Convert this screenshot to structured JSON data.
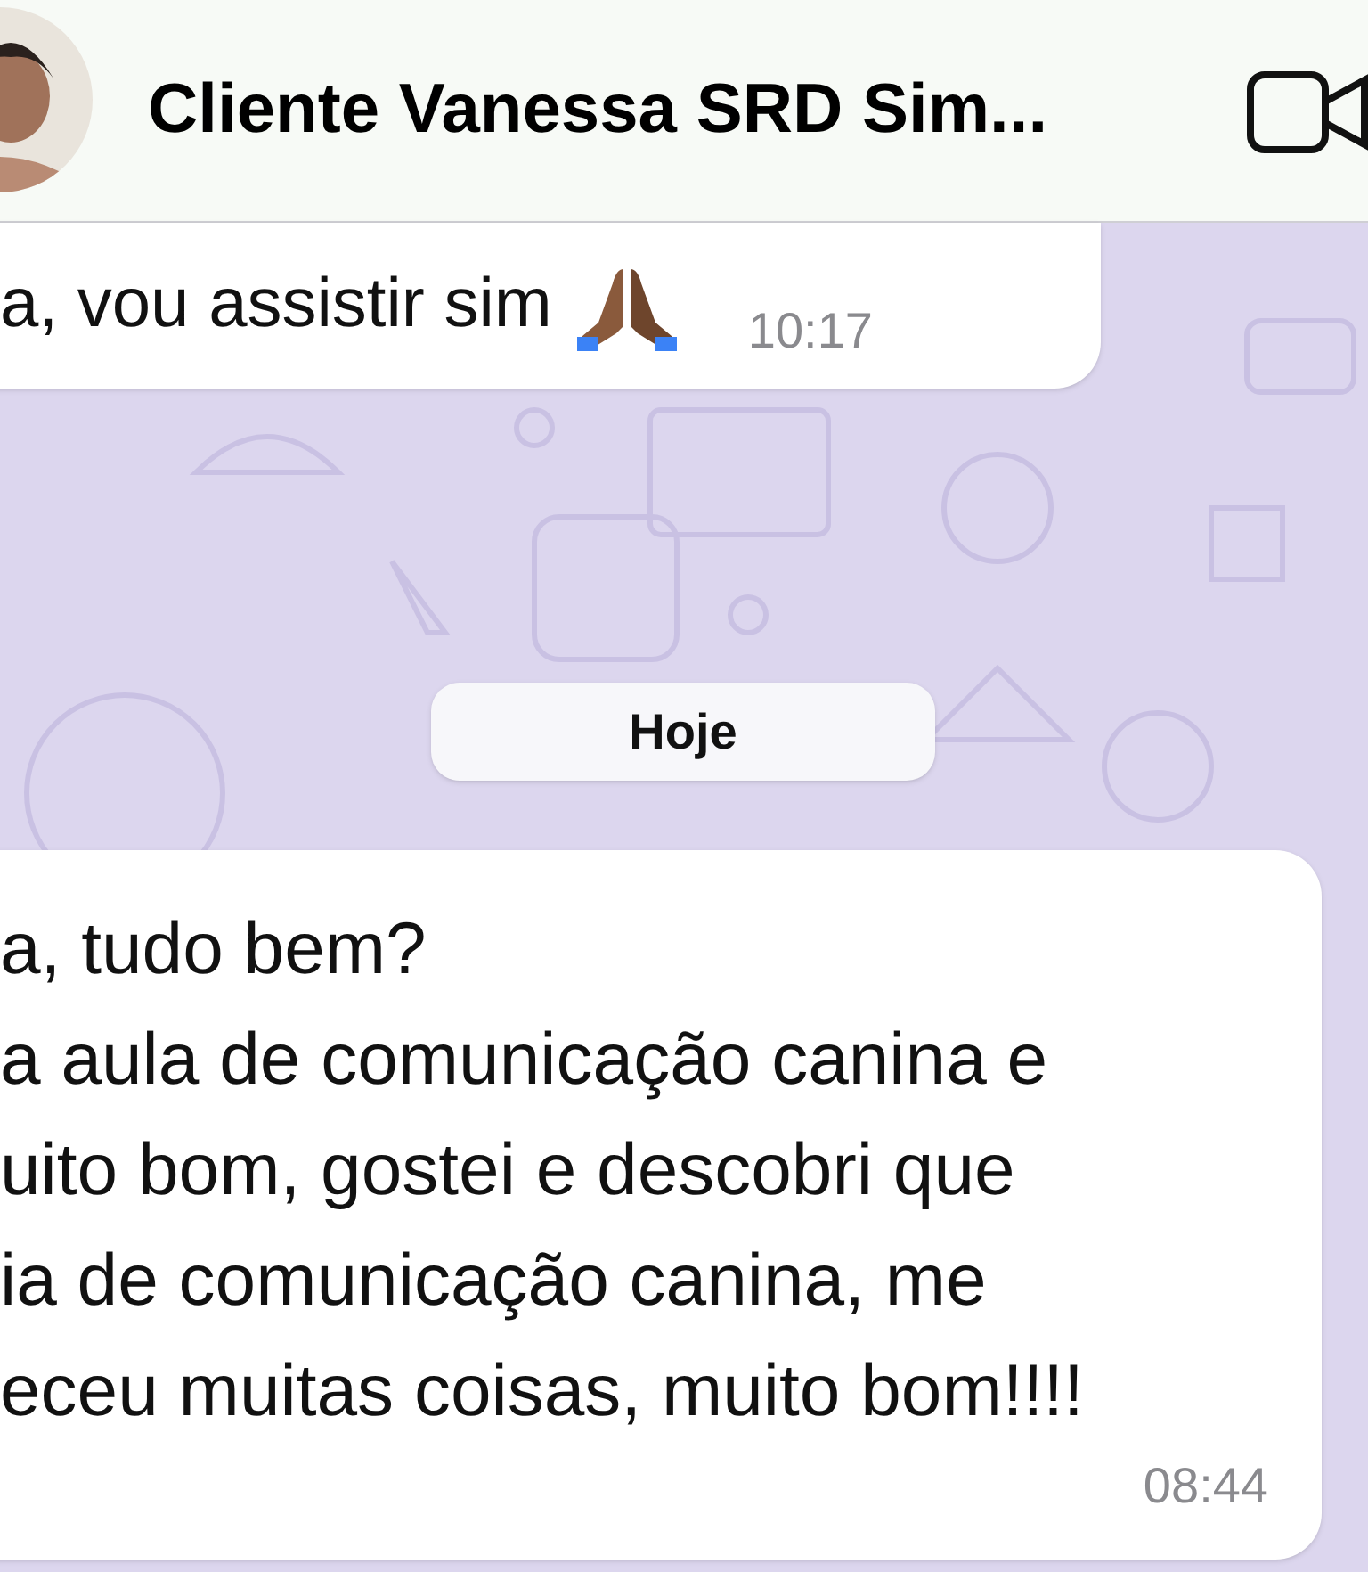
{
  "header": {
    "title": "Cliente Vanessa SRD Sim..."
  },
  "messages": [
    {
      "kind": "bubble",
      "text": "a, vou assistir sim",
      "emoji_icon": true,
      "time": "10:17"
    },
    {
      "kind": "date",
      "text": "Hoje"
    },
    {
      "kind": "bubble",
      "text": "a, tudo bem?\na aula de comunicação canina e\nuito bom, gostei e descobri que\nia de comunicação canina, me\neceu muitas coisas, muito bom!!!!",
      "time": "08:44"
    }
  ]
}
